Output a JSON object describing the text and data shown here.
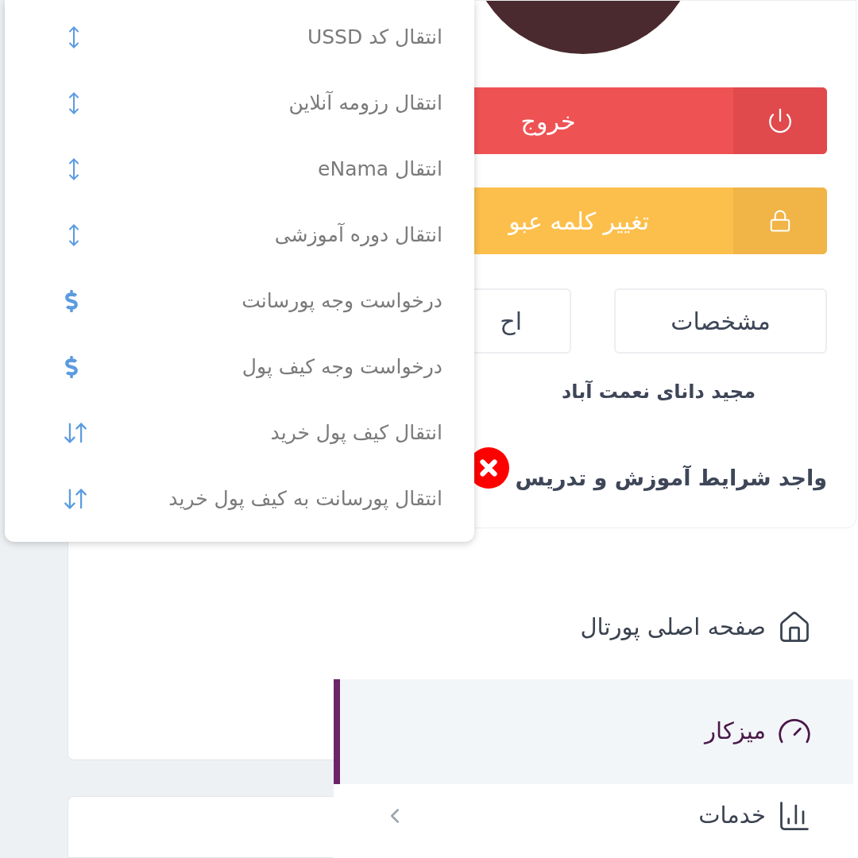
{
  "menu": {
    "items": [
      {
        "label": "انتقال کد USSD",
        "kind": "vertical"
      },
      {
        "label": "انتقال رزومه آنلاین",
        "kind": "vertical"
      },
      {
        "label": "انتقال eNama",
        "kind": "vertical"
      },
      {
        "label": "انتقال دوره آموزشی",
        "kind": "vertical"
      },
      {
        "label": "درخواست وجه پورسانت",
        "kind": "dollar"
      },
      {
        "label": "درخواست وجه کیف پول",
        "kind": "dollar"
      },
      {
        "label": "انتقال کیف پول خرید",
        "kind": "swap"
      },
      {
        "label": "انتقال پورسانت به کیف پول خرید",
        "kind": "swap"
      }
    ]
  },
  "profile": {
    "actions": [
      {
        "label": "خروج",
        "kind": "logout"
      },
      {
        "label": "تغییر کلمه عبو",
        "kind": "password"
      }
    ],
    "tabs": [
      {
        "label": "مشخصات"
      },
      {
        "label": "اح"
      }
    ],
    "name": "مجید دانای نعمت آباد",
    "status": {
      "label": "واجد شرایط آموزش و تدریس",
      "eligible": false
    }
  },
  "nav": [
    {
      "label": "صفحه اصلی پورتال",
      "kind": "home",
      "selected": false,
      "expandable": false
    },
    {
      "label": "میزکار",
      "kind": "gauge",
      "selected": true,
      "expandable": false
    },
    {
      "label": "خدمات",
      "kind": "chart",
      "selected": false,
      "expandable": true
    }
  ]
}
